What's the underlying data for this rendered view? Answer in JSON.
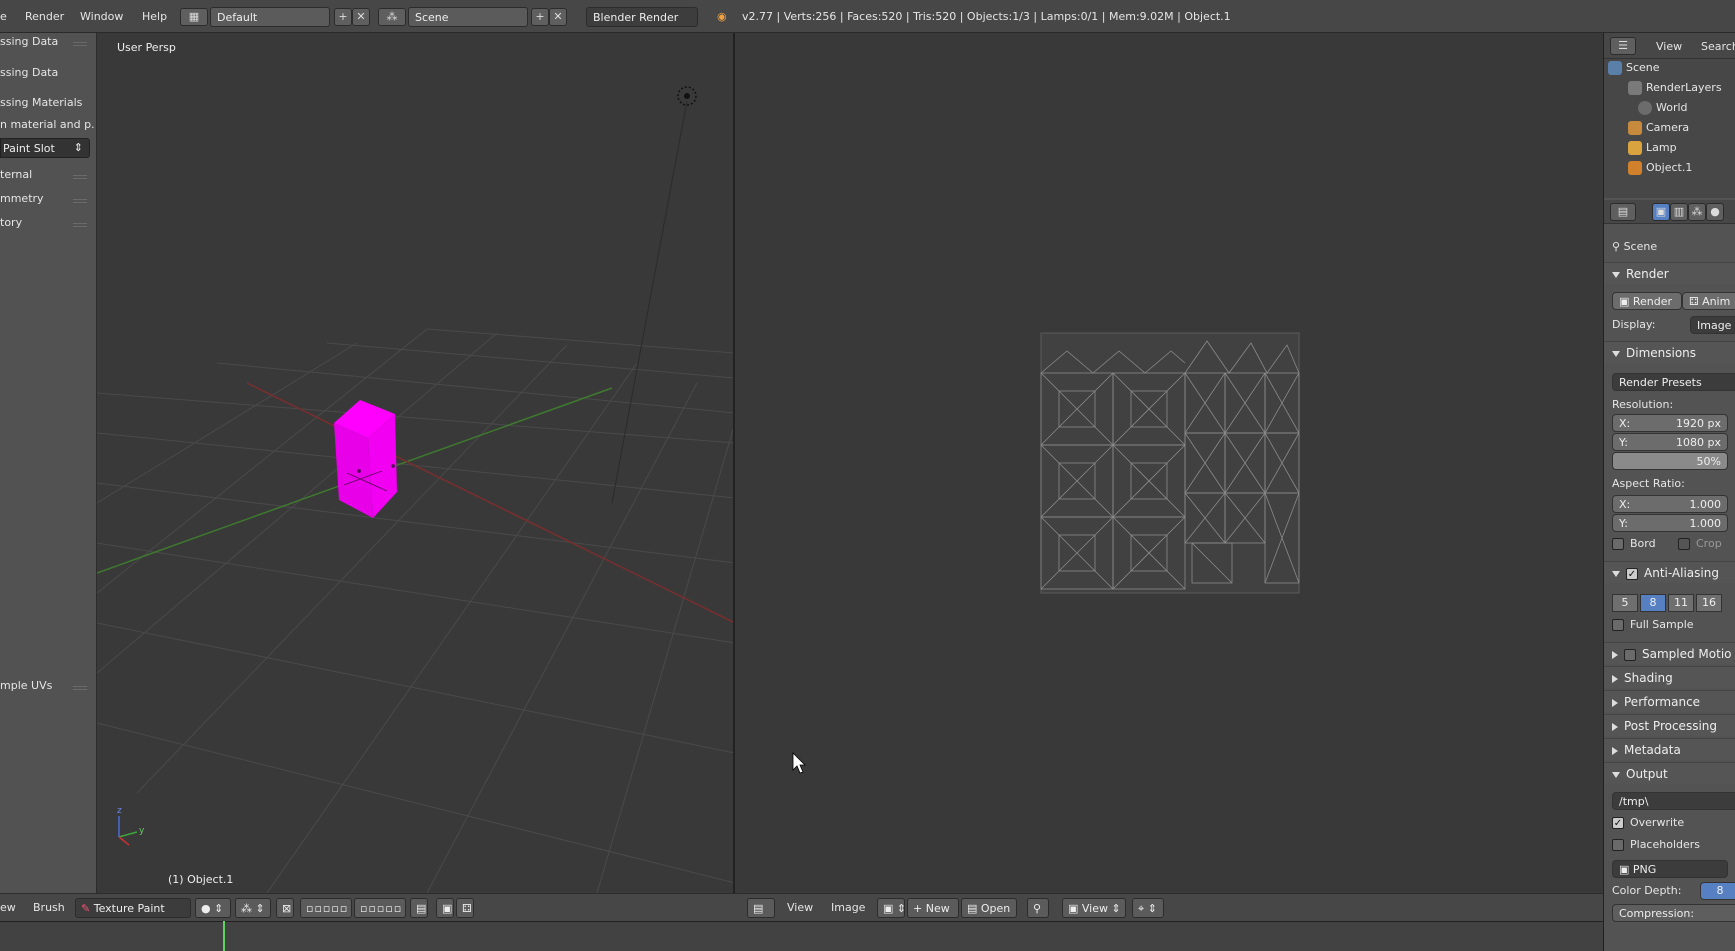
{
  "topbar": {
    "menus": [
      "e",
      "Render",
      "Window",
      "Help"
    ],
    "screen_layout": "Default",
    "scene": "Scene",
    "engine": "Blender Render",
    "stats": "v2.77 | Verts:256 | Faces:520 | Tris:520 | Objects:1/3 | Lamps:0/1 | Mem:9.02M | Object.1"
  },
  "toolshelf": {
    "items": [
      "ssing Data",
      "ssing Data",
      "ssing Materials",
      "n material and p...",
      "Paint Slot",
      "ternal",
      "mmetry",
      "tory",
      "mple UVs"
    ]
  },
  "viewport3d": {
    "view_label": "User Persp",
    "object_label": "(1) Object.1",
    "cube_color": "#ff00ff"
  },
  "outliner": {
    "header": [
      "View",
      "Search"
    ],
    "tree": [
      "Scene",
      "RenderLayers",
      "World",
      "Camera",
      "Lamp",
      "Object.1"
    ]
  },
  "properties": {
    "context": "Scene",
    "render_panel": "Render",
    "render_btn": "Render",
    "anim_btn": "Anim",
    "display_label": "Display:",
    "display_value": "Image",
    "dimensions_panel": "Dimensions",
    "presets": "Render Presets",
    "resolution_label": "Resolution:",
    "res_x_label": "X:",
    "res_x": "1920 px",
    "res_y_label": "Y:",
    "res_y": "1080 px",
    "res_pct": "50%",
    "aspect_label": "Aspect Ratio:",
    "asp_x_label": "X:",
    "asp_x": "1.000",
    "asp_y_label": "Y:",
    "asp_y": "1.000",
    "bord": "Bord",
    "crop": "Crop",
    "aa_panel": "Anti-Aliasing",
    "aa_samples": [
      "5",
      "8",
      "11",
      "16"
    ],
    "aa_selected": "8",
    "full_sample": "Full Sample",
    "sampled_motion": "Sampled Motio",
    "shading": "Shading",
    "performance": "Performance",
    "post_processing": "Post Processing",
    "metadata": "Metadata",
    "output_panel": "Output",
    "output_path": "/tmp\\",
    "overwrite": "Overwrite",
    "placeholders": "Placeholders",
    "format": "PNG",
    "color_depth_label": "Color Depth:",
    "color_depth_value": "8",
    "compression_label": "Compression:"
  },
  "bottom3d": {
    "items": [
      "ew",
      "Brush"
    ],
    "mode": "Texture Paint"
  },
  "bottomimg": {
    "menus": [
      "View",
      "Image"
    ],
    "new": "New",
    "open": "Open",
    "view": "View"
  }
}
